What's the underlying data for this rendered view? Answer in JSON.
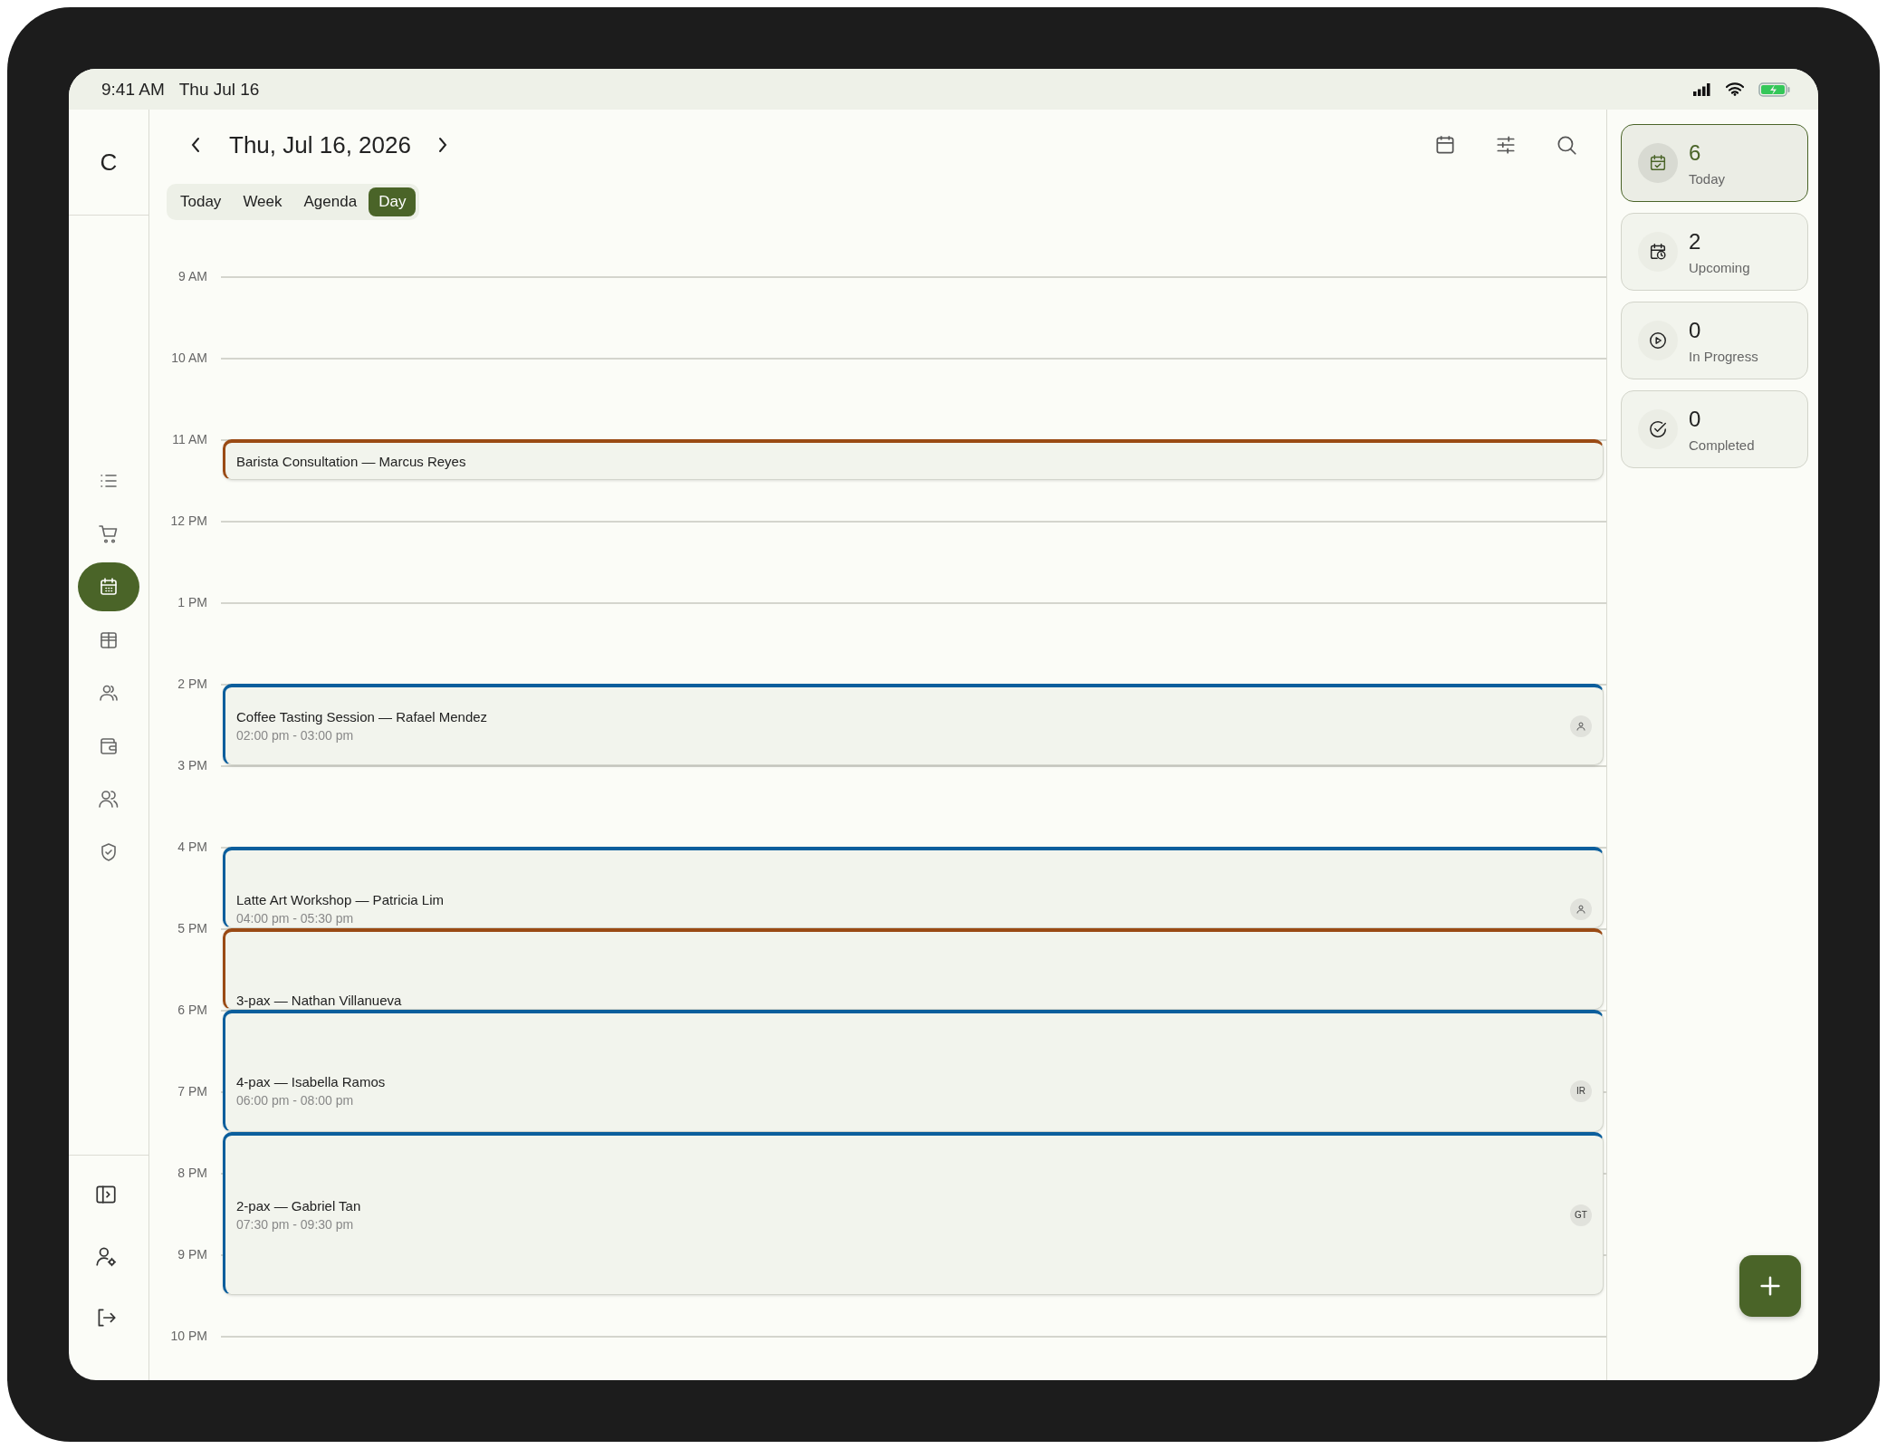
{
  "status_bar": {
    "time": "9:41 AM",
    "date": "Thu Jul 16"
  },
  "sidebar": {
    "logo": "C",
    "nav": [
      {
        "kind": "list",
        "selected": false
      },
      {
        "kind": "cart",
        "selected": false
      },
      {
        "kind": "calendar",
        "selected": true
      },
      {
        "kind": "table",
        "selected": false
      },
      {
        "kind": "users",
        "selected": false
      },
      {
        "kind": "wallet",
        "selected": false
      },
      {
        "kind": "team",
        "selected": false
      },
      {
        "kind": "shield",
        "selected": false
      }
    ],
    "footer": [
      {
        "kind": "panel"
      },
      {
        "kind": "user-settings"
      },
      {
        "kind": "logout"
      }
    ]
  },
  "header": {
    "title": "Thu, Jul 16, 2026",
    "views": [
      {
        "label": "Today",
        "selected": false
      },
      {
        "label": "Week",
        "selected": false
      },
      {
        "label": "Agenda",
        "selected": false
      },
      {
        "label": "Day",
        "selected": true
      }
    ]
  },
  "timeline": {
    "hours": [
      "9 AM",
      "10 AM",
      "11 AM",
      "12 PM",
      "1 PM",
      "2 PM",
      "3 PM",
      "4 PM",
      "5 PM",
      "6 PM",
      "7 PM",
      "8 PM",
      "9 PM",
      "10 PM"
    ],
    "events": [
      {
        "title": "Barista Consultation — Marcus Reyes",
        "color": "#9a4a14"
      },
      {
        "title": "Coffee Tasting Session — Rafael Mendez",
        "time": "02:00 pm - 03:00 pm",
        "color": "#0b5e9c",
        "avatar": {
          "kind": "person"
        }
      },
      {
        "title": "Latte Art Workshop — Patricia Lim",
        "time": "04:00 pm - 05:30 pm",
        "color": "#0b5e9c",
        "avatar": {
          "kind": "person"
        }
      },
      {
        "title": "3-pax — Nathan Villanueva",
        "color": "#9a4a14"
      },
      {
        "title": "4-pax — Isabella Ramos",
        "time": "06:00 pm - 08:00 pm",
        "color": "#0b5e9c",
        "avatar": {
          "kind": "initials",
          "text": "IR"
        }
      },
      {
        "title": "2-pax — Gabriel Tan",
        "time": "07:30 pm - 09:30 pm",
        "color": "#0b5e9c",
        "avatar": {
          "kind": "initials",
          "text": "GT"
        }
      }
    ]
  },
  "stats": [
    {
      "kind": "today",
      "value": "6",
      "label": "Today",
      "selected": true
    },
    {
      "kind": "upcoming",
      "value": "2",
      "label": "Upcoming",
      "selected": false
    },
    {
      "kind": "progress",
      "value": "0",
      "label": "In Progress",
      "selected": false
    },
    {
      "kind": "completed",
      "value": "0",
      "label": "Completed",
      "selected": false
    }
  ]
}
